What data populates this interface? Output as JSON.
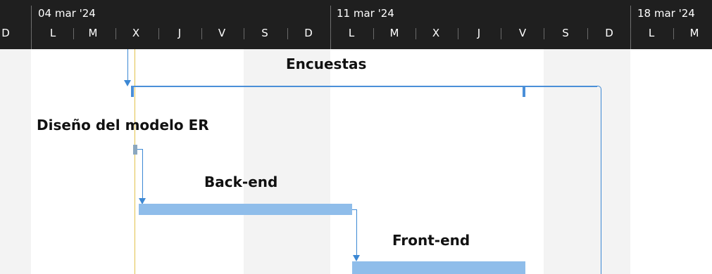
{
  "timescale": {
    "weeks": [
      {
        "label": "04 mar '24"
      },
      {
        "label": "11 mar '24"
      },
      {
        "label": "18 mar '24"
      }
    ],
    "days": [
      "D",
      "L",
      "M",
      "X",
      "J",
      "V",
      "S",
      "D",
      "L",
      "M",
      "X",
      "J",
      "V",
      "S",
      "D",
      "L",
      "M"
    ]
  },
  "tasks": {
    "encuestas": "Encuestas",
    "diseno": "Diseño del modelo ER",
    "backend": "Back-end",
    "frontend": "Front-end"
  },
  "colors": {
    "timescale_bg": "#1f1f1f",
    "weekend_shade": "#f3f3f3",
    "task_bar": "#8fbdea",
    "summary": "#4a8fd8",
    "link": "#3c88d4",
    "today_line": "#e2c14c"
  }
}
